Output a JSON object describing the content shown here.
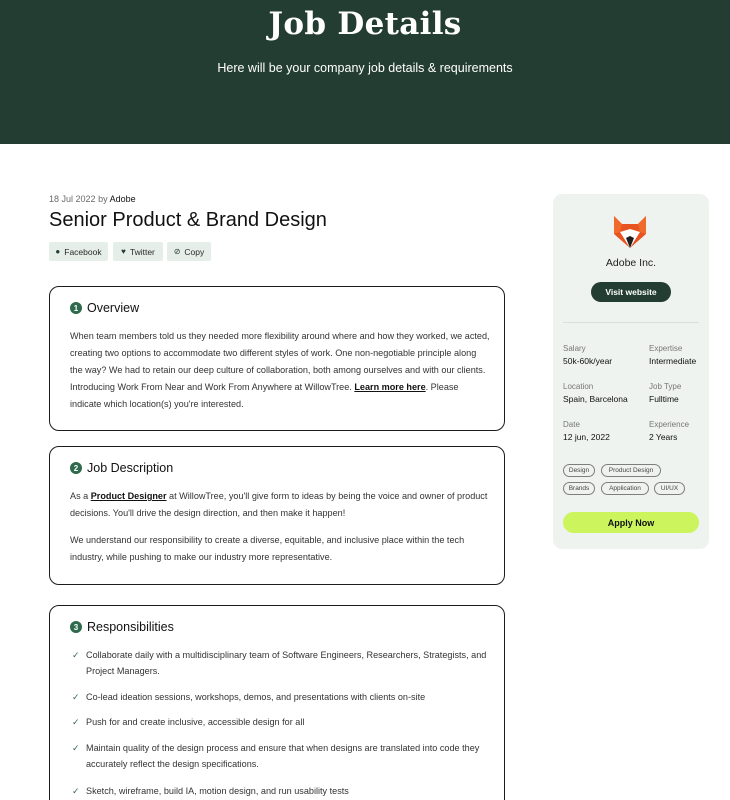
{
  "hero": {
    "title": "Job Details",
    "subtitle": "Here will be your company job details & requirements"
  },
  "job": {
    "date": "18 Jul 2022",
    "by_word": "by",
    "company": "Adobe",
    "title": "Senior Product & Brand Design"
  },
  "share": [
    {
      "label": "Facebook",
      "icon": "facebook-icon"
    },
    {
      "label": "Twitter",
      "icon": "twitter-icon"
    },
    {
      "label": "Copy",
      "icon": "link-icon"
    }
  ],
  "overview": {
    "number": "1",
    "heading": "Overview",
    "text_before": "When team members told us they needed more flexibility around where and how they worked, we acted, creating two options to accommodate two different styles of work. One non-negotiable principle along the way? We had to retain our deep culture of collaboration, both among ourselves and with our clients. Introducing Work From Near and Work From Anywhere at WillowTree. ",
    "link": "Learn more here",
    "text_after": ". Please indicate which location(s) you're interested."
  },
  "description": {
    "number": "2",
    "heading": "Job Description",
    "p1_before": "As a ",
    "p1_link": "Product Designer",
    "p1_after": " at WillowTree, you'll give form to ideas by being the voice and owner of product decisions. You'll drive the design direction, and then make it happen!",
    "p2": "We understand our responsibility to create a diverse, equitable, and inclusive place within the tech industry, while pushing to make our industry more representative."
  },
  "responsibilities": {
    "number": "3",
    "heading": "Responsibilities",
    "items": [
      "Collaborate daily with a multidisciplinary team of Software Engineers, Researchers, Strategists, and Project Managers.",
      "Co-lead ideation sessions, workshops, demos, and presentations with clients on-site",
      "Push for and create inclusive, accessible design for all",
      "Maintain quality of the design process and ensure that when designs are translated into code they accurately reflect the design specifications.",
      "Sketch, wireframe, build IA, motion design, and run usability tests"
    ]
  },
  "sidebar": {
    "company": "Adobe Inc.",
    "visit_label": "Visit website",
    "info": [
      {
        "label": "Salary",
        "value": "50k-60k/year"
      },
      {
        "label": "Expertise",
        "value": "Intermediate"
      },
      {
        "label": "Location",
        "value": "Spain, Barcelona"
      },
      {
        "label": "Job Type",
        "value": "Fulltime"
      },
      {
        "label": "Date",
        "value": "12 jun, 2022"
      },
      {
        "label": "Experience",
        "value": "2 Years"
      }
    ],
    "tags": [
      "Design",
      "Product Design",
      "Brands",
      "Application",
      "UI/UX"
    ],
    "apply_label": "Apply Now"
  },
  "colors": {
    "hero_bg": "#233d33",
    "accent_green": "#2f6a4c",
    "apply_bg": "#cbf45d",
    "sidebar_bg": "#eef3f0"
  }
}
